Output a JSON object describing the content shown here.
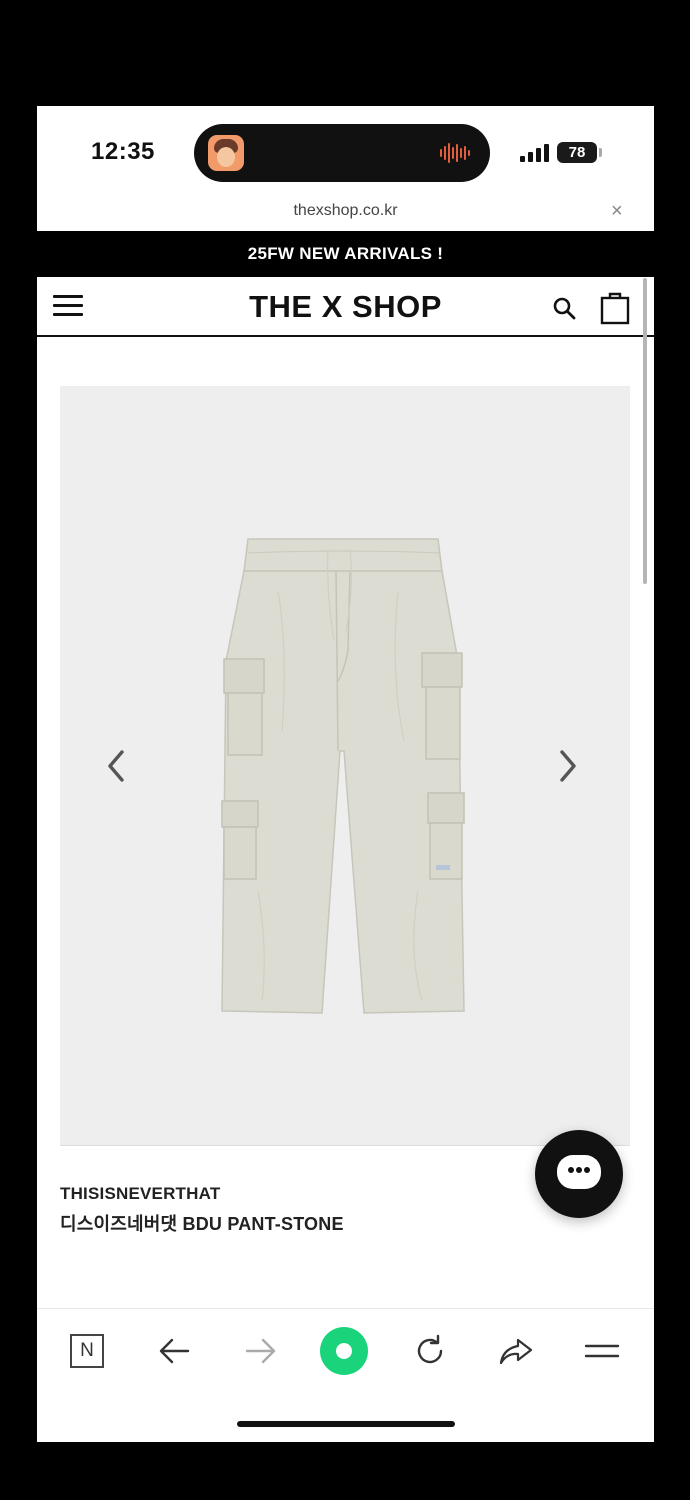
{
  "status_bar": {
    "time": "12:35",
    "battery": "78",
    "icons": [
      "signal-icon",
      "battery-icon",
      "audio-waveform-icon"
    ]
  },
  "browser": {
    "url": "thexshop.co.kr",
    "close_icon": "×"
  },
  "announcement": {
    "text": "25FW NEW ARRIVALS !"
  },
  "header": {
    "logo": "THE X SHOP",
    "icons": [
      "menu-icon",
      "search-icon",
      "shopping-bag-icon"
    ]
  },
  "product": {
    "brand": "THISISNEVERTHAT",
    "name": "디스이즈네버댓 BDU PANT-STONE",
    "image_bg": "#eeeeef",
    "garment_color": "#dcdcd2"
  },
  "toolbar": {
    "n_label": "N",
    "home_color": "#19d47b",
    "icons": [
      "naver-n-icon",
      "back-arrow-icon",
      "forward-arrow-icon",
      "home-icon",
      "reload-icon",
      "share-icon",
      "menu-icon"
    ]
  }
}
